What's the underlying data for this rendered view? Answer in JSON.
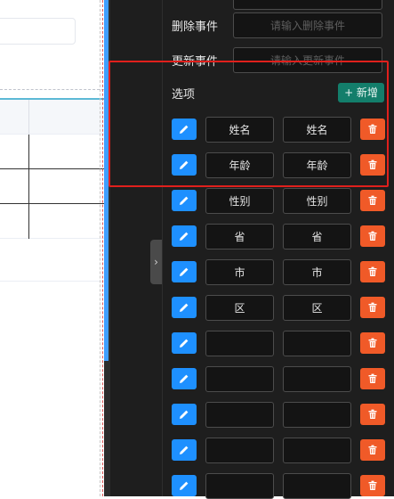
{
  "panel": {
    "fields": [
      {
        "label": "删除事件",
        "placeholder": "请输入删除事件"
      },
      {
        "label": "更新事件",
        "placeholder": "请输入更新事件"
      }
    ],
    "options_label": "选项",
    "add_button_label": "+ 新增",
    "options": [
      {
        "label": "姓名",
        "value": "姓名"
      },
      {
        "label": "年龄",
        "value": "年龄"
      },
      {
        "label": "性别",
        "value": "性别"
      },
      {
        "label": "省",
        "value": "省"
      },
      {
        "label": "市",
        "value": "市"
      },
      {
        "label": "区",
        "value": "区"
      },
      {
        "label": "",
        "value": ""
      },
      {
        "label": "",
        "value": ""
      },
      {
        "label": "",
        "value": ""
      },
      {
        "label": "",
        "value": ""
      },
      {
        "label": "",
        "value": ""
      }
    ],
    "collapse_icon": "chevron-right-icon"
  },
  "colors": {
    "panel_bg": "#1e1e1e",
    "edit_button": "#1e90ff",
    "delete_button": "#f05a28",
    "add_button": "#137e6b",
    "highlight": "#e0201c",
    "canvas_scroll_thumb": "#409eff"
  }
}
